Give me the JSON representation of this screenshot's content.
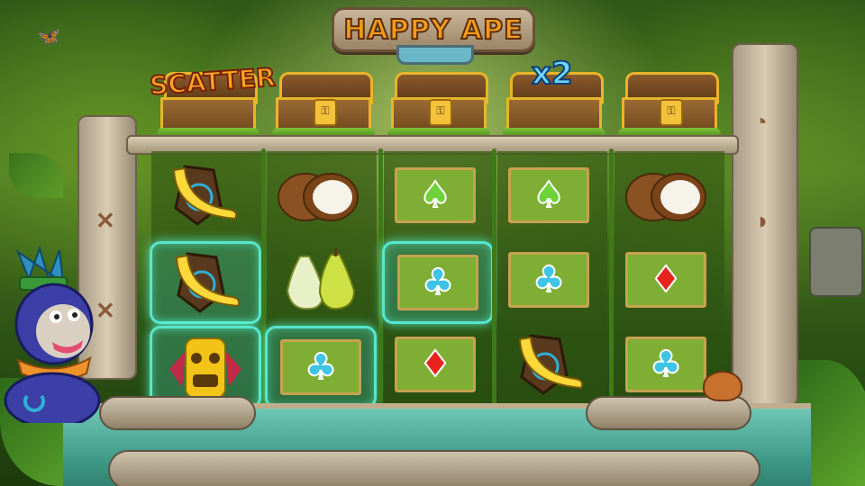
{
  "game": {
    "title": "HAPPY APE",
    "chest_labels": [
      "SCATTER",
      "",
      "",
      "x2",
      ""
    ],
    "chest_lock_glyph": "⚿"
  },
  "reels": [
    [
      "banana",
      "banana",
      "tiki-mask"
    ],
    [
      "coconut",
      "pear",
      "club"
    ],
    [
      "spade",
      "club",
      "diamond"
    ],
    [
      "spade",
      "club",
      "banana"
    ],
    [
      "coconut",
      "diamond",
      "club"
    ]
  ],
  "highlighted": [
    [
      0,
      1
    ],
    [
      0,
      2
    ],
    [
      1,
      2
    ],
    [
      2,
      1
    ]
  ],
  "suit_glyphs": {
    "spade": "♠",
    "club": "♣",
    "diamond": "♦"
  },
  "colors": {
    "title_fill": "#f39a1b",
    "scatter_fill": "#f6a624",
    "multiplier_fill": "#6fd6ff",
    "highlight": "#57e6cf",
    "spade": "#6fd23a",
    "club": "#3fc4e6",
    "diamond": "#e8231d"
  },
  "pillar_glyphs": {
    "left": [
      "✕",
      "✕"
    ],
    "right": [
      "◔",
      "◑"
    ]
  },
  "decor": {
    "butterfly": "🦋"
  }
}
